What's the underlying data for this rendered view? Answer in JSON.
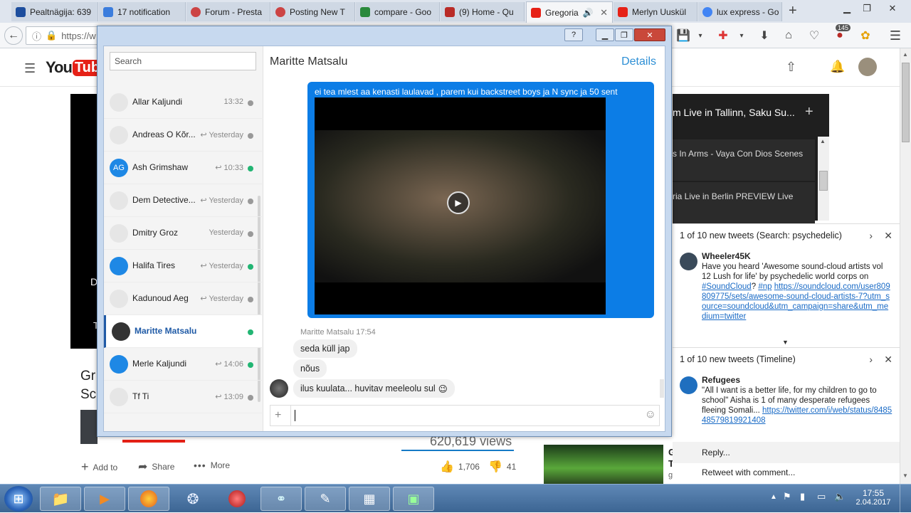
{
  "browser": {
    "tabs": [
      {
        "label": "Pealtnägija: 639",
        "color": "#1d4e9e"
      },
      {
        "label": "17 notification",
        "color": "#3b7ddd"
      },
      {
        "label": "Forum - Presta",
        "color": "#c44"
      },
      {
        "label": "Posting New T",
        "color": "#c44"
      },
      {
        "label": "compare - Goo",
        "color": "#2a8a3c"
      },
      {
        "label": "(9) Home - Qu",
        "color": "#b92b27"
      },
      {
        "label": "Gregoria",
        "color": "#e62117"
      },
      {
        "label": "Merlyn Uuskül",
        "color": "#e62117"
      },
      {
        "label": "lux express - Go",
        "color": "#4285f4"
      }
    ],
    "new_tab": "+",
    "badge_count": "145"
  },
  "youtube": {
    "logo": "YouTube",
    "video_title": "Gr",
    "video_title2": "Sc",
    "views": "620,619 views",
    "add_to": "Add to",
    "share": "Share",
    "more": "More",
    "likes": "1,706",
    "dislikes": "41",
    "playlist_title": "m Live in Tallinn, Saku Su...",
    "playlist_item1": "s In Arms - Vaya Con Dios Scenes",
    "playlist_item2": "ria Live in Berlin PREVIEW Live",
    "side_letter1": "G",
    "side_letter2": "T",
    "side_letter3": "g",
    "player_letter": "D",
    "player_letter2": "T"
  },
  "messenger": {
    "search_placeholder": "Search",
    "contact_name": "Maritte Matsalu",
    "details": "Details",
    "contacts": [
      {
        "name": "Allar Kaljundi",
        "time": "13:32",
        "online": false,
        "initials": ""
      },
      {
        "name": "Andreas O Kõr...",
        "time": "↩ Yesterday",
        "online": false,
        "initials": ""
      },
      {
        "name": "Ash Grimshaw",
        "time": "↩ 10:33",
        "online": true,
        "initials": "AG"
      },
      {
        "name": "Dem Detective...",
        "time": "↩ Yesterday",
        "online": false,
        "initials": ""
      },
      {
        "name": "Dmitry Groz",
        "time": "Yesterday",
        "online": false,
        "initials": ""
      },
      {
        "name": "Halifa Tires",
        "time": "↩ Yesterday",
        "online": true,
        "initials": ""
      },
      {
        "name": "Kadunoud Aeg",
        "time": "↩ Yesterday",
        "online": false,
        "initials": ""
      },
      {
        "name": "Maritte Matsalu",
        "time": "",
        "online": true,
        "initials": ""
      },
      {
        "name": "Merle Kaljundi",
        "time": "↩ 14:06",
        "online": true,
        "initials": ""
      },
      {
        "name": "Tf Ti",
        "time": "↩ 13:09",
        "online": false,
        "initials": ""
      }
    ],
    "sent_message": "ei tea mlest aa kenasti laulavad , parem kui backstreet boys ja N sync ja 50 sent",
    "sender_line": "Maritte Matsalu",
    "sender_time": "17:54",
    "received": [
      "seda küll jap",
      "nõus",
      "ilus kuulata... huvitav meeleolu sul"
    ],
    "emoji": "😉"
  },
  "tweets": {
    "n1_header": "1 of 10 new tweets (Search: psychedelic)",
    "n1_user": "Wheeler45K",
    "n1_text": "Have you heard 'Awesome sound-cloud artists vol 12 Lush for life' by psychedelic world corps on",
    "n1_tag1": "#SoundCloud",
    "n1_q": "?",
    "n1_tag2": "#np",
    "n1_link": "https://soundcloud.com/user809809775/sets/awesome-sound-cloud-artists-7?utm_source=soundcloud&utm_campaign=share&utm_medium=twitter",
    "n2_header": "1 of 10 new tweets (Timeline)",
    "n2_user": "Refugees",
    "n2_text": "\"All I want is a better life, for my children to go to school\" Aisha is 1 of many desperate refugees fleeing Somali...",
    "n2_link": "https://twitter.com/i/web/status/848548579819921408",
    "reply": "Reply...",
    "retweet": "Retweet with comment..."
  },
  "taskbar": {
    "time": "17:55",
    "date": "2.04.2017"
  }
}
